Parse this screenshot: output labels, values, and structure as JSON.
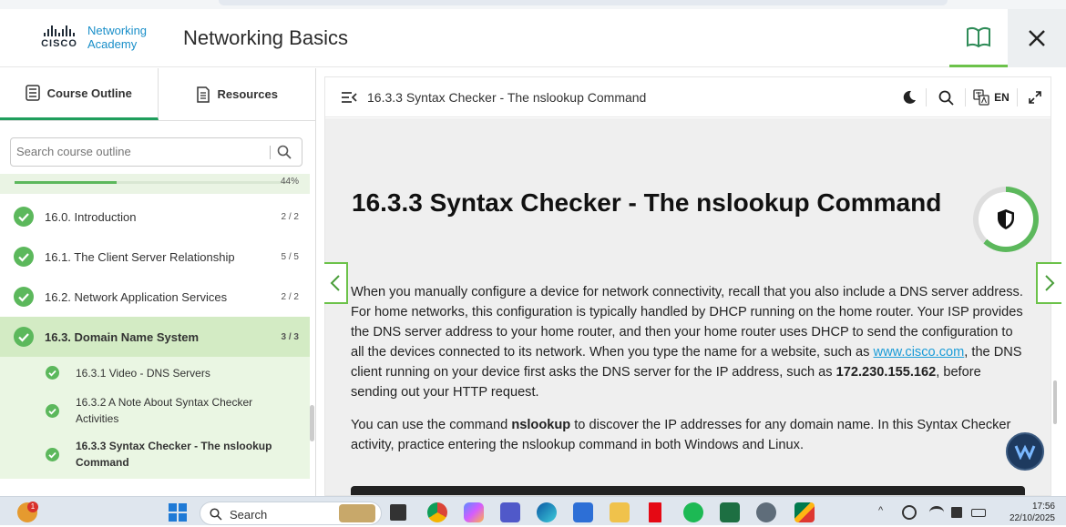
{
  "header": {
    "logo_word": "CISCO",
    "logo_sub_line1": "Networking",
    "logo_sub_line2": "Academy",
    "course_title": "Networking Basics"
  },
  "sidebar": {
    "tabs": [
      {
        "label": "Course Outline",
        "icon": "outline-icon",
        "active": true
      },
      {
        "label": "Resources",
        "icon": "resources-icon",
        "active": false
      }
    ],
    "search_placeholder": "Search course outline",
    "progress_label": "44%",
    "progress_fraction": 0.44,
    "modules": [
      {
        "label": "16.0. Introduction",
        "count": "2 / 2"
      },
      {
        "label": "16.1. The Client Server Relationship",
        "count": "5 / 5"
      },
      {
        "label": "16.2. Network Application Services",
        "count": "2 / 2"
      },
      {
        "label": "16.3. Domain Name System",
        "count": "3 / 3"
      }
    ],
    "subitems": [
      {
        "label": "16.3.1 Video - DNS Servers"
      },
      {
        "label_line1": "16.3.2 A Note About Syntax Checker",
        "label_line2": "Activities"
      },
      {
        "label_line1": "16.3.3 Syntax Checker - The nslookup",
        "label_line2": "Command"
      }
    ]
  },
  "main": {
    "topbar_title": "16.3.3 Syntax Checker - The nslookup Command",
    "language": "EN",
    "heading": "16.3.3 Syntax Checker - The nslookup Command",
    "para1": {
      "part1": "When you manually configure a device for network connectivity, recall that you also include a DNS server address. For home networks, this configuration is typically handled by DHCP running on the home router. Your ISP provides the DNS server address to your home router, and then your home router uses DHCP to send the configuration to all the devices connected to its network. When you type the name for a website, such as ",
      "link": "www.cisco.com",
      "part2": ", the DNS client running on your device first asks the DNS server for the IP address, such as ",
      "bold": "172.230.155.162",
      "part3": ", before sending out your HTTP request."
    },
    "para2": {
      "part1": "You can use the command ",
      "bold": "nslookup",
      "part2": " to discover the IP addresses for any domain name. In this Syntax Checker activity, practice entering the nslookup command in both Windows and Linux."
    }
  },
  "taskbar": {
    "search_label": "Search",
    "notification_count": "1",
    "time": "17:56",
    "date": "22/10/2025"
  },
  "colors": {
    "green": "#5cb85c",
    "accent_green": "#6cc24a",
    "link": "#1a9cd8",
    "cisco_blue": "#1a8fc9"
  }
}
